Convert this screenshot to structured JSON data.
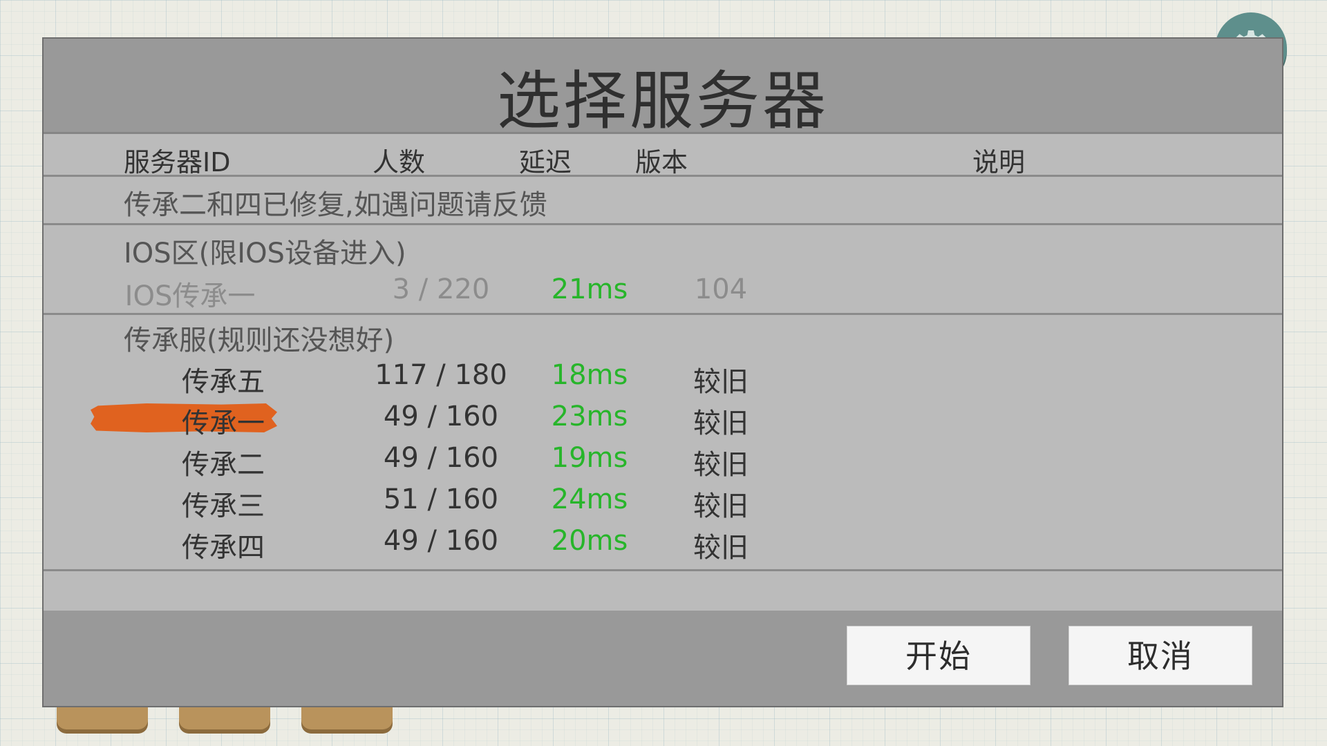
{
  "modal": {
    "title": "选择服务器",
    "columns": {
      "id": "服务器ID",
      "count": "人数",
      "ping": "延迟",
      "version": "版本",
      "desc": "说明"
    },
    "notice": "传承二和四已修复,如遇问题请反馈",
    "groups": [
      {
        "title": "IOS区(限IOS设备进入)",
        "servers": [
          {
            "id": "IOS传承一",
            "count": "3 / 220",
            "ping": "21ms",
            "version": "104",
            "disabled": true
          }
        ]
      },
      {
        "title": "传承服(规则还没想好)",
        "servers": [
          {
            "id": "传承五",
            "count": "117 / 180",
            "ping": "18ms",
            "version": "较旧"
          },
          {
            "id": "传承一",
            "count": "49 / 160",
            "ping": "23ms",
            "version": "较旧",
            "selected": true
          },
          {
            "id": "传承二",
            "count": "49 / 160",
            "ping": "19ms",
            "version": "较旧"
          },
          {
            "id": "传承三",
            "count": "51 / 160",
            "ping": "24ms",
            "version": "较旧"
          },
          {
            "id": "传承四",
            "count": "49 / 160",
            "ping": "20ms",
            "version": "较旧"
          }
        ]
      }
    ],
    "buttons": {
      "start": "开始",
      "cancel": "取消"
    }
  },
  "colors": {
    "ping": "#27b52a",
    "selected_highlight": "#e0621f",
    "header_bg": "#999999",
    "body_bg": "#bbbbbb"
  },
  "icons": {
    "settings": "gear-icon"
  }
}
